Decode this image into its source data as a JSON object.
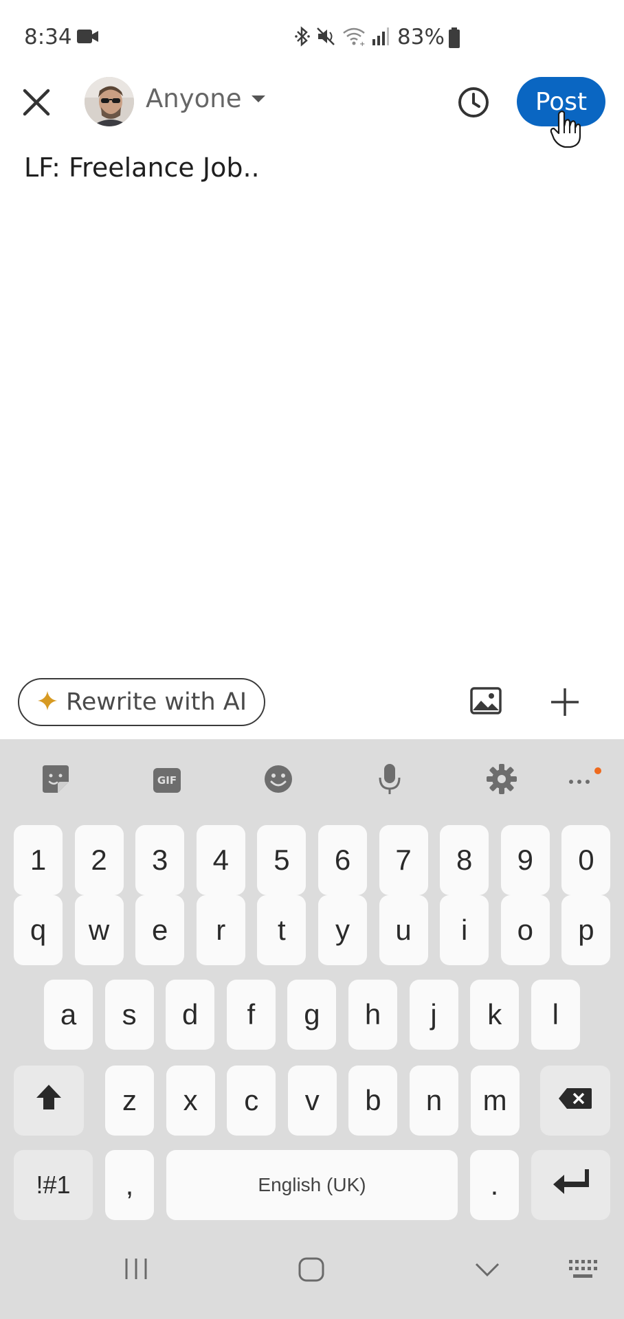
{
  "status_bar": {
    "time": "8:34",
    "battery_percent": "83%",
    "icons": [
      "video-camera-icon",
      "bluetooth-icon",
      "mute-icon",
      "wifi-icon",
      "signal-icon",
      "battery-icon"
    ]
  },
  "header": {
    "audience_label": "Anyone",
    "post_label": "Post",
    "post_color": "#0a66c2",
    "icons": [
      "close-icon",
      "clock-icon"
    ]
  },
  "editor": {
    "text": "LF: Freelance Job.."
  },
  "composer_toolbar": {
    "ai_button_label": "Rewrite with AI",
    "ai_icon_color": "#d79a22",
    "icons": [
      "sparkle-icon",
      "image-icon",
      "plus-icon"
    ]
  },
  "keyboard": {
    "toolbar_icons": [
      "sticker-icon",
      "gif-icon",
      "emoji-icon",
      "microphone-icon",
      "settings-icon",
      "more-icon"
    ],
    "gif_label": "GIF",
    "row_numbers": [
      "1",
      "2",
      "3",
      "4",
      "5",
      "6",
      "7",
      "8",
      "9",
      "0"
    ],
    "row_top": [
      "q",
      "w",
      "e",
      "r",
      "t",
      "y",
      "u",
      "i",
      "o",
      "p"
    ],
    "row_middle": [
      "a",
      "s",
      "d",
      "f",
      "g",
      "h",
      "j",
      "k",
      "l"
    ],
    "row_bottom": [
      "z",
      "x",
      "c",
      "v",
      "b",
      "n",
      "m"
    ],
    "symbols_label": "!#1",
    "comma_label": ",",
    "space_label": "English (UK)",
    "period_label": "."
  },
  "nav_bar": {
    "icons": [
      "recent-apps-icon",
      "home-icon",
      "back-icon",
      "keyboard-switch-icon"
    ]
  }
}
